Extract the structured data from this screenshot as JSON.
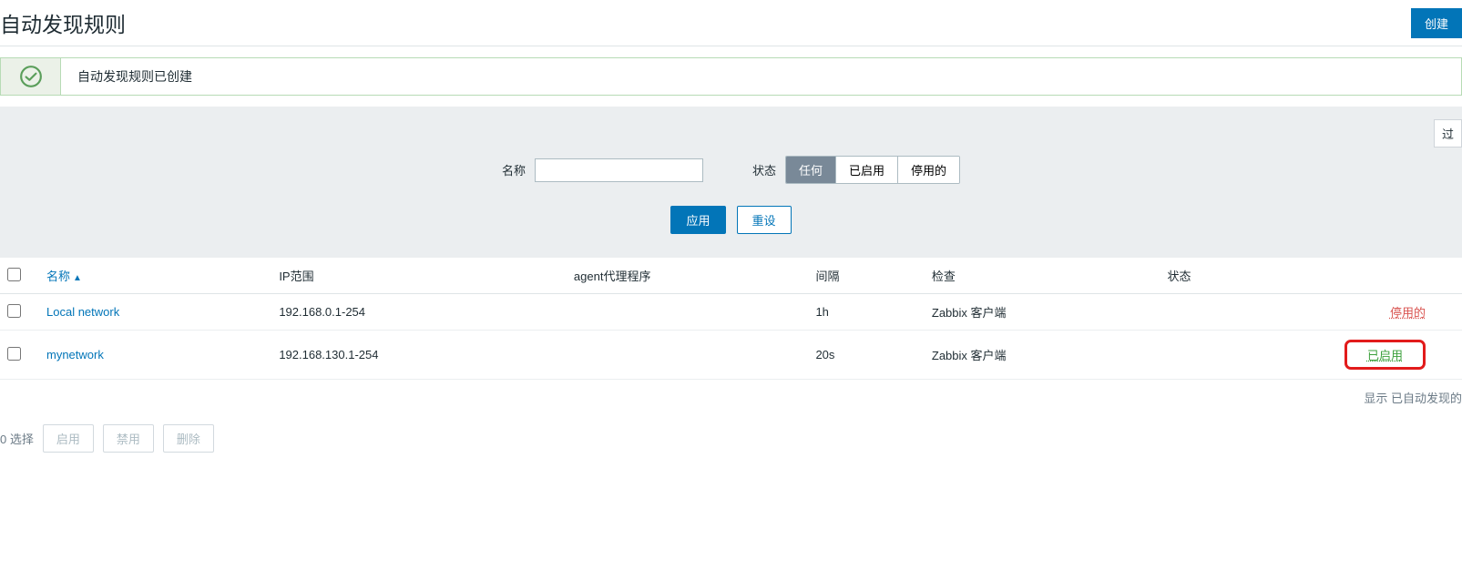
{
  "header": {
    "title": "自动发现规则",
    "create_label": "创建"
  },
  "alert": {
    "message": "自动发现规则已创建"
  },
  "filter": {
    "toggle_label": "过",
    "name_label": "名称",
    "name_value": "",
    "status_label": "状态",
    "status_any": "任何",
    "status_enabled": "已启用",
    "status_disabled": "停用的",
    "apply_label": "应用",
    "reset_label": "重设"
  },
  "table": {
    "col_name": "名称",
    "col_iprange": "IP范围",
    "col_agent": "agent代理程序",
    "col_interval": "间隔",
    "col_check": "检查",
    "col_status": "状态",
    "rows": [
      {
        "name": "Local network",
        "iprange": "192.168.0.1-254",
        "agent": "",
        "interval": "1h",
        "check": "Zabbix 客户端",
        "status": "停用的",
        "status_class": "disabled"
      },
      {
        "name": "mynetwork",
        "iprange": "192.168.130.1-254",
        "agent": "",
        "interval": "20s",
        "check": "Zabbix 客户端",
        "status": "已启用",
        "status_class": "enabled"
      }
    ]
  },
  "footer": {
    "display_label": "显示 已自动发现的"
  },
  "bulk": {
    "selected_label": "选择",
    "selected_count": "0",
    "enable_label": "启用",
    "disable_label": "禁用",
    "delete_label": "删除"
  }
}
